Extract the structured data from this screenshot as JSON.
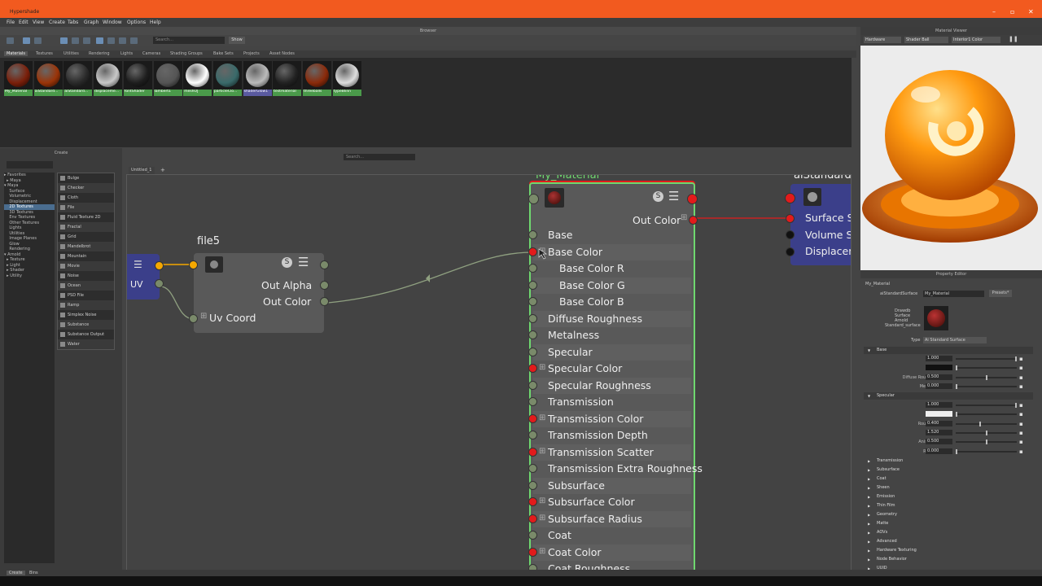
{
  "window": {
    "title": "Hypershade",
    "min": "–",
    "max": "▫",
    "close": "✕"
  },
  "menu": [
    "File",
    "Edit",
    "View",
    "Create",
    "Tabs",
    "Graph",
    "Window",
    "Options",
    "Help"
  ],
  "browser": {
    "header": "Browser",
    "search_placeholder": "Search...",
    "show_label": "Show",
    "tabs": [
      "Materials",
      "Textures",
      "Utilities",
      "Rendering",
      "Lights",
      "Cameras",
      "Shading Groups",
      "Bake Sets",
      "Projects",
      "Asset Nodes"
    ],
    "swatches": [
      {
        "label": "My_Material",
        "color": "#7a1f0a"
      },
      {
        "label": "aiStandard...",
        "color": "#9a3408"
      },
      {
        "label": "aiStandard...",
        "color": "#2a2a2a"
      },
      {
        "label": "displaceme...",
        "color": "#c8c8c8"
      },
      {
        "label": "fontShader",
        "color": "#1e1e1e"
      },
      {
        "label": "lambert1",
        "color": "#555555"
      },
      {
        "label": "meshOJ",
        "color": "#ffffff"
      },
      {
        "label": "particleClo...",
        "color": "#3a6a6a"
      },
      {
        "label": "shaderGlow1",
        "color": "#bbbbbb"
      },
      {
        "label": "testmaterial",
        "color": "#222222"
      },
      {
        "label": "threeballs",
        "color": "#8a2a0a"
      },
      {
        "label": "typeBlinn",
        "color": "#dddddd"
      }
    ]
  },
  "create": {
    "header": "Create",
    "tree": [
      "▸ Favorites",
      "  ▸ Maya",
      "▾ Maya",
      "    Surface",
      "    Volumetric",
      "    Displacement",
      "    2D Textures",
      "    3D Textures",
      "    Env Textures",
      "    Other Textures",
      "    Lights",
      "    Utilities",
      "    Image Planes",
      "    Glow",
      "    Rendering",
      "▾ Arnold",
      "  ▸ Texture",
      "  ▸ Light",
      "  ▸ Shader",
      "  ▸ Utility"
    ],
    "selected_tree_index": 6,
    "items": [
      "Bulge",
      "Checker",
      "Cloth",
      "File",
      "Fluid Texture 2D",
      "Fractal",
      "Grid",
      "Mandelbrot",
      "Mountain",
      "Movie",
      "Noise",
      "Ocean",
      "PSD File",
      "Ramp",
      "Simplex Noise",
      "Substance",
      "Substance Output",
      "Water"
    ]
  },
  "graph": {
    "tab_label": "Untitled_1",
    "tab_add": "+",
    "search_placeholder": "Search...",
    "place2d_label": "UV",
    "file_node": {
      "title": "file5",
      "attrs": [
        "Out Alpha",
        "Out Color",
        "Uv Coord"
      ]
    },
    "material_node": {
      "title": "My_Material",
      "out_label": "Out Color",
      "attrs": [
        {
          "label": "Base",
          "port": "normal",
          "plus": false,
          "indent": false
        },
        {
          "label": "Base Color",
          "port": "red",
          "plus": true,
          "indent": false
        },
        {
          "label": "Base Color R",
          "port": "normal",
          "plus": false,
          "indent": true
        },
        {
          "label": "Base Color G",
          "port": "normal",
          "plus": false,
          "indent": true
        },
        {
          "label": "Base Color B",
          "port": "normal",
          "plus": false,
          "indent": true
        },
        {
          "label": "Diffuse Roughness",
          "port": "normal",
          "plus": false,
          "indent": false
        },
        {
          "label": "Metalness",
          "port": "normal",
          "plus": false,
          "indent": false
        },
        {
          "label": "Specular",
          "port": "normal",
          "plus": false,
          "indent": false
        },
        {
          "label": "Specular Color",
          "port": "red",
          "plus": true,
          "indent": false
        },
        {
          "label": "Specular Roughness",
          "port": "normal",
          "plus": false,
          "indent": false
        },
        {
          "label": "Transmission",
          "port": "normal",
          "plus": false,
          "indent": false
        },
        {
          "label": "Transmission Color",
          "port": "red",
          "plus": true,
          "indent": false
        },
        {
          "label": "Transmission Depth",
          "port": "normal",
          "plus": false,
          "indent": false
        },
        {
          "label": "Transmission Scatter",
          "port": "red",
          "plus": true,
          "indent": false
        },
        {
          "label": "Transmission Extra Roughness",
          "port": "normal",
          "plus": false,
          "indent": false
        },
        {
          "label": "Subsurface",
          "port": "normal",
          "plus": false,
          "indent": false
        },
        {
          "label": "Subsurface Color",
          "port": "red",
          "plus": true,
          "indent": false
        },
        {
          "label": "Subsurface Radius",
          "port": "red",
          "plus": true,
          "indent": false
        },
        {
          "label": "Coat",
          "port": "normal",
          "plus": false,
          "indent": false
        },
        {
          "label": "Coat Color",
          "port": "red",
          "plus": true,
          "indent": false
        },
        {
          "label": "Coat Roughness",
          "port": "normal",
          "plus": false,
          "indent": false
        }
      ]
    },
    "sg_node": {
      "title": "aiStandardS",
      "attrs": [
        "Surface Sh",
        "Volume Sh",
        "Displacem"
      ]
    }
  },
  "viewer": {
    "header": "Material Viewer",
    "renderer": "Hardware",
    "shape": "Shader Ball",
    "env": "Interior1 Color"
  },
  "property_editor": {
    "header": "Property Editor",
    "node_name": "My_Material",
    "type_label": "aiStandardSurface",
    "name_value": "My_Material",
    "presets": "Presets*",
    "classification": [
      "Drawdb",
      "Surface",
      "Arnold",
      "Standard_surface"
    ],
    "type_field_label": "Type",
    "type_value": "Ai Standard Surface",
    "base": {
      "title": "Base",
      "rows": [
        {
          "label": "Weight",
          "value": "1.000",
          "level": 1.0
        },
        {
          "label": "Color",
          "value": "",
          "level": 0.0,
          "color": "#111111"
        },
        {
          "label": "Diffuse Roughness",
          "value": "0.500",
          "level": 0.5
        },
        {
          "label": "Metalness",
          "value": "0.000",
          "level": 0.0
        }
      ]
    },
    "specular": {
      "title": "Specular",
      "rows": [
        {
          "label": "Weight",
          "value": "1.000",
          "level": 1.0
        },
        {
          "label": "Color",
          "value": "",
          "level": 0.0,
          "color": "#eeeeee"
        },
        {
          "label": "Roughness",
          "value": "0.400",
          "level": 0.4
        },
        {
          "label": "IOR ≡",
          "value": "1.520",
          "level": 0.5
        },
        {
          "label": "Anisotropy",
          "value": "0.500",
          "level": 0.5
        },
        {
          "label": "Rotation",
          "value": "0.000",
          "level": 0.0
        }
      ]
    },
    "collapsed_sections": [
      "Transmission",
      "Subsurface",
      "Coat",
      "Sheen",
      "Emission",
      "Thin Film",
      "Geometry",
      "Matte",
      "AOVs",
      "Advanced",
      "Hardware Texturing",
      "Node Behavior",
      "UUID"
    ]
  },
  "status": {
    "create": "Create",
    "bins": "Bins"
  },
  "colors": {
    "accent": "#f25a1f",
    "selection_green": "#4a9a4a",
    "port_red": "#e21b1b",
    "port_yellow": "#f5a800",
    "sg_blue": "#3b3f8a"
  }
}
